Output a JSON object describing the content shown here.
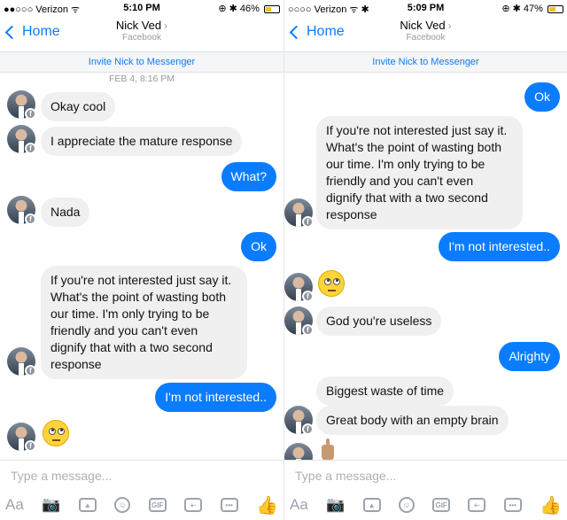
{
  "left": {
    "status": {
      "carrier": "●●○○○ Verizon ᯤ",
      "time": "5:10 PM",
      "right_icons": "⊕ ✱ 46%",
      "battery_pct": 0.46
    },
    "nav": {
      "back_label": "Home",
      "contact_name": "Nick Ved",
      "contact_chevron": "›",
      "contact_sub": "Facebook"
    },
    "invite_label": "Invite Nick to Messenger",
    "date_stamp": "FEB 4, 8:16 PM",
    "messages": [
      {
        "dir": "in",
        "text": "Okay cool"
      },
      {
        "dir": "in",
        "text": "I appreciate the mature response"
      },
      {
        "dir": "out",
        "text": "What?"
      },
      {
        "dir": "in",
        "text": "Nada"
      },
      {
        "dir": "out",
        "text": "Ok"
      },
      {
        "dir": "in",
        "text": "If you're not interested just say it.\nWhat's the point of wasting both\nour time. I'm only trying to be\nfriendly and you can't even\ndignify that with a two second\nresponse"
      },
      {
        "dir": "out",
        "text": "I'm not interested.."
      },
      {
        "dir": "in",
        "emoji": "eye-roll-emoji"
      }
    ],
    "composer": {
      "placeholder": "Type a message...",
      "aa_label": "Aa",
      "gif_label": "GIF"
    }
  },
  "right": {
    "status": {
      "carrier": "○○○○ Verizon ᯤ ✱",
      "time": "5:09 PM",
      "right_icons": "⊕ ✱ 47%",
      "battery_pct": 0.47
    },
    "nav": {
      "back_label": "Home",
      "contact_name": "Nick Ved",
      "contact_chevron": "›",
      "contact_sub": "Facebook"
    },
    "invite_label": "Invite Nick to Messenger",
    "messages": [
      {
        "dir": "out",
        "text": "Ok"
      },
      {
        "dir": "in",
        "text": "If you're not interested just say it.\nWhat's the point of wasting both\nour time. I'm only trying to be\nfriendly and you can't even\ndignify that with a two second\nresponse"
      },
      {
        "dir": "out",
        "text": "I'm not interested.."
      },
      {
        "dir": "in",
        "emoji": "eye-roll-emoji"
      },
      {
        "dir": "in",
        "text": "God you're useless"
      },
      {
        "dir": "out",
        "text": "Alrighty"
      },
      {
        "dir": "in",
        "text": "Biggest waste of time"
      },
      {
        "dir": "in",
        "text": "Great body with an empty brain"
      },
      {
        "dir": "in",
        "emoji": "middle-finger-emoji"
      }
    ],
    "composer": {
      "placeholder": "Type a message...",
      "aa_label": "Aa",
      "gif_label": "GIF"
    }
  },
  "colors": {
    "accent": "#0a7cff",
    "incoming_bubble": "#f1f0f0"
  }
}
